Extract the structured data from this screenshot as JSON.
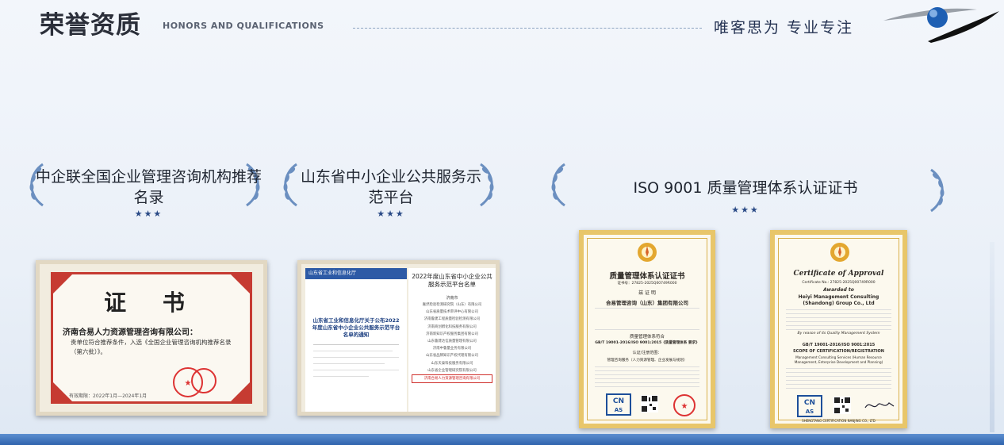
{
  "header": {
    "title": "荣誉资质",
    "subtitle": "HONORS AND QUALIFICATIONS",
    "slogan": "唯客思为 专业专注"
  },
  "awards": [
    {
      "title": "中企联全国企业管理咨询机构推荐名录",
      "stars": "★★★"
    },
    {
      "title": "山东省中小企业公共服务示范平台",
      "stars": "★★★"
    },
    {
      "title": "ISO 9001 质量管理体系认证证书",
      "stars": "★★★"
    }
  ],
  "cert1": {
    "heading": "证  书",
    "company": "济南合易人力资源管理咨询有限公司：",
    "body": "贵单位符合推荐条件，入选《全国企业管理咨询机构推荐名录（第六批）》。",
    "date": "有效期限：2022年1月—2024年1月"
  },
  "cert2": {
    "left_header": "山东省工业和信息化厅",
    "left_title": "山东省工业和信息化厅关于公布2022年度山东省中小企业公共服务示范平台名单的通知",
    "right_title": "2022年度山东省中小企业公共服务示范平台名单",
    "city": "济南市",
    "list": [
      "嘉然检验检测研究院（山东）有限公司",
      "山东省质量技术审评中心有限公司",
      "济南鲁建工程质量检验检测有限公司",
      "济南商创孵化科技服务有限公司",
      "济南新知识产权服务集团有限公司",
      "山东鲁建达信质量管理有限公司",
      "济南中鲁量业务有限公司",
      "山东省品牌知识产权代理有限公司",
      "山东天泰科技服务有限公司",
      "山东省企业管理研究院有限公司",
      "济南合易人力资源管理咨询有限公司"
    ]
  },
  "cert3": {
    "title": "质量管理体系认证证书",
    "cert_no": "证书号：27825-2025Q00749R000",
    "proof": "兹 证 明",
    "company": "合易管理咨询（山东）集团有限公司",
    "standard": "质量管理体系符合",
    "standard2": "GB/T 19001-2016/ISO 9001:2015《质量管理体系 要求》",
    "scope_label": "认证/注册范围：",
    "scope": "管理咨询服务（人力资源管理、企业发展与规划）"
  },
  "cert4": {
    "title": "Certificate of Approval",
    "cert_no": "Certificate No.: 27825-2025Q00749R000",
    "awarded": "Awarded to",
    "company": "Heiyi Management Consulting (Shandong) Group Co., Ltd",
    "purpose": "By reason of its Quality Management System",
    "standard": "GB/T 19001-2016/ISO 9001:2015",
    "scope_title": "SCOPE OF CERTIFICATION/REGISTRATION",
    "scope": "Management Consulting Services (Human Resource Management, Enterprise Development and Planning)",
    "footer": "SHENGTANG CERTIFICATION NANJING CO., LTD"
  },
  "colors": {
    "accent": "#2f63ad",
    "gold": "#e8c66a",
    "star": "#2a4a86"
  }
}
